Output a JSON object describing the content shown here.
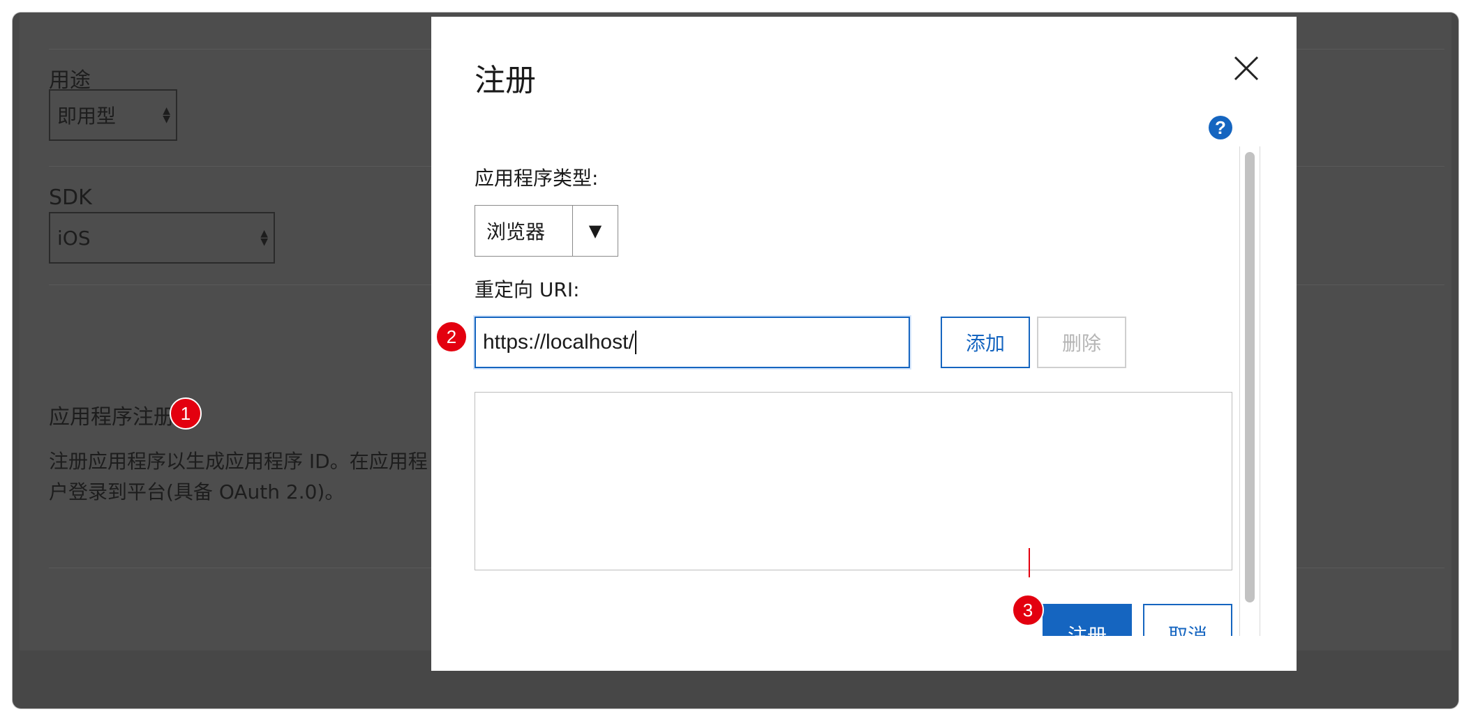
{
  "background": {
    "purpose_label": "用途",
    "purpose_value": "即用型",
    "sdk_label": "SDK",
    "sdk_value": "iOS",
    "app_registration_heading": "应用程序注册",
    "app_registration_desc_line1": "注册应用程序以生成应用程序 ID。在应用程",
    "app_registration_desc_line2": "户登录到平台(具备 OAuth 2.0)。"
  },
  "modal": {
    "title": "注册",
    "help_glyph": "?",
    "close_glyph": "close-icon",
    "app_type_label": "应用程序类型:",
    "app_type_value": "浏览器",
    "redirect_uri_label": "重定向 URI:",
    "redirect_uri_value": "https://localhost/",
    "add_label": "添加",
    "delete_label": "删除",
    "register_label": "注册",
    "cancel_label": "取消"
  },
  "badges": [
    "1",
    "2",
    "3"
  ],
  "colors": {
    "accent": "#1565c0",
    "badge": "#e3000f",
    "overlay": "#474747"
  }
}
